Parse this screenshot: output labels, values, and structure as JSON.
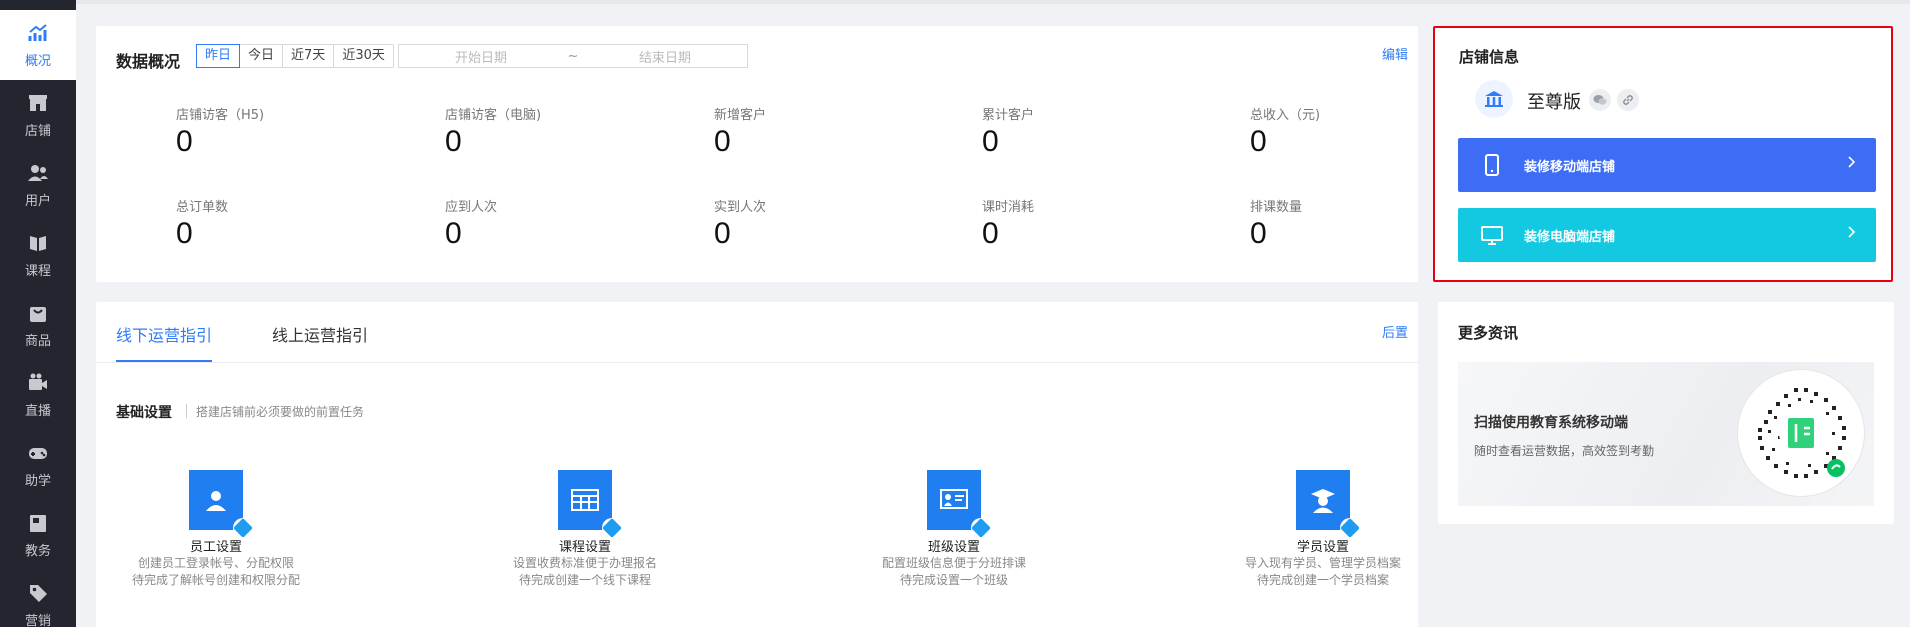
{
  "sidebar": {
    "items": [
      {
        "label": "概况",
        "icon": "trend-chart-icon",
        "active": true
      },
      {
        "label": "店铺",
        "icon": "shop-icon"
      },
      {
        "label": "用户",
        "icon": "users-icon"
      },
      {
        "label": "课程",
        "icon": "book-icon"
      },
      {
        "label": "商品",
        "icon": "bag-icon"
      },
      {
        "label": "直播",
        "icon": "video-camera-icon"
      },
      {
        "label": "助学",
        "icon": "gamepad-icon"
      },
      {
        "label": "教务",
        "icon": "calendar-book-icon"
      },
      {
        "label": "营销",
        "icon": "tag-icon"
      }
    ]
  },
  "overview": {
    "title": "数据概况",
    "ranges": [
      "昨日",
      "今日",
      "近7天",
      "近30天"
    ],
    "active_range": "昨日",
    "date_start_placeholder": "开始日期",
    "date_sep": "~",
    "date_end_placeholder": "结束日期",
    "edit_label": "编辑",
    "metrics_row1": [
      {
        "label": "店铺访客（H5)",
        "value": "0"
      },
      {
        "label": "店铺访客（电脑)",
        "value": "0"
      },
      {
        "label": "新增客户",
        "value": "0"
      },
      {
        "label": "累计客户",
        "value": "0"
      },
      {
        "label": "总收入（元)",
        "value": "0"
      }
    ],
    "metrics_row2": [
      {
        "label": "总订单数",
        "value": "0"
      },
      {
        "label": "应到人次",
        "value": "0"
      },
      {
        "label": "实到人次",
        "value": "0"
      },
      {
        "label": "课时消耗",
        "value": "0"
      },
      {
        "label": "排课数量",
        "value": "0"
      }
    ]
  },
  "guide": {
    "tabs": [
      "线下运营指引",
      "线上运营指引"
    ],
    "active_tab": "线下运营指引",
    "collapse_label": "后置",
    "basic_title": "基础设置",
    "basic_desc": "搭建店铺前必须要做的前置任务",
    "tasks": [
      {
        "title": "员工设置",
        "line1": "创建员工登录帐号、分配权限",
        "line2": "待完成了解帐号创建和权限分配",
        "icon": "staff-icon"
      },
      {
        "title": "课程设置",
        "line1": "设置收费标准便于办理报名",
        "line2": "待完成创建一个线下课程",
        "icon": "course-grid-icon"
      },
      {
        "title": "班级设置",
        "line1": "配置班级信息便于分班排课",
        "line2": "待完成设置一个班级",
        "icon": "classroom-icon"
      },
      {
        "title": "学员设置",
        "line1": "导入现有学员、管理学员档案",
        "line2": "待完成创建一个学员档案",
        "icon": "graduate-icon"
      }
    ]
  },
  "store": {
    "title": "店铺信息",
    "name": "至尊版",
    "decorate_mobile": "装修移动端店铺",
    "decorate_pc": "装修电脑端店铺"
  },
  "news": {
    "title": "更多资讯",
    "banner_title": "扫描使用教育系统移动端",
    "banner_desc": "随时查看运营数据，高效签到考勤"
  },
  "colors": {
    "accent": "#2f7cf6",
    "sidebar_bg": "#23262e",
    "mobile_button": "#3d6df5",
    "pc_button": "#13c9e2",
    "highlight_border": "#e60012"
  }
}
